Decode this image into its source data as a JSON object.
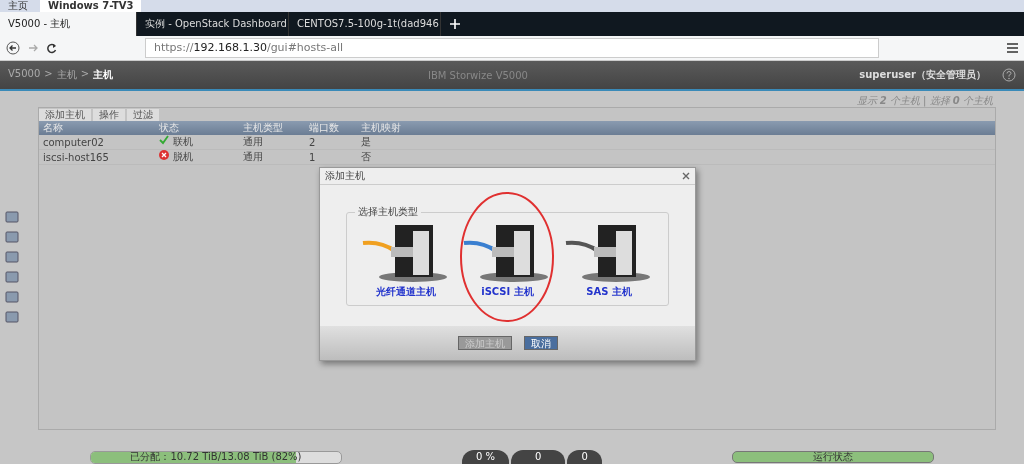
{
  "vm_tabs": [
    {
      "label": "主页",
      "selected": false
    },
    {
      "label": "Windows 7-TV3",
      "selected": true
    }
  ],
  "browser_tabs": [
    {
      "label": "V5000 - 主机",
      "selected": true
    },
    {
      "label": "实例 - OpenStack Dashboard",
      "selected": false
    },
    {
      "label": "CENTOS7.5-100g-1t(dad946",
      "selected": false
    }
  ],
  "address_bar": {
    "scheme": "https://",
    "host": "192.168.1.30",
    "path": "/gui#hosts-all"
  },
  "app_header": {
    "breadcrumb": [
      "V5000",
      ">",
      "主机",
      ">",
      "主机"
    ],
    "product": "IBM Storwize V5000",
    "user": "superuser（安全管理员）"
  },
  "toolbar": {
    "actions": [
      "添加主机",
      "操作",
      "过滤"
    ],
    "summary": "显示 **2** 个主机 | 选择 **0** 个主机"
  },
  "table": {
    "columns": [
      "名称",
      "状态",
      "主机类型",
      "端口数",
      "主机映射"
    ],
    "rows": [
      {
        "name": "computer02",
        "status": "联机",
        "kind": "online",
        "type": "通用",
        "ports": "2",
        "mapping": "是"
      },
      {
        "name": "iscsi-host165",
        "status": "脱机",
        "kind": "offline",
        "type": "通用",
        "ports": "1",
        "mapping": "否"
      }
    ]
  },
  "dialog": {
    "title": "添加主机",
    "group_label": "选择主机类型",
    "options": [
      {
        "label": "光纤通道主机",
        "kind": "fibre",
        "circled": false
      },
      {
        "label": "iSCSI 主机",
        "kind": "ethernet",
        "circled": true
      },
      {
        "label": "SAS 主机",
        "kind": "sas",
        "circled": false
      }
    ],
    "buttons": [
      {
        "label": "添加主机",
        "disabled": true
      },
      {
        "label": "取消",
        "disabled": false
      }
    ]
  },
  "status_bar": {
    "capacity": {
      "text": "已分配：10.72 TiB/13.08 TiB (82%)",
      "level": 0.82
    },
    "gauges": [
      "0 %",
      "0",
      "0"
    ],
    "health": "运行状态"
  }
}
